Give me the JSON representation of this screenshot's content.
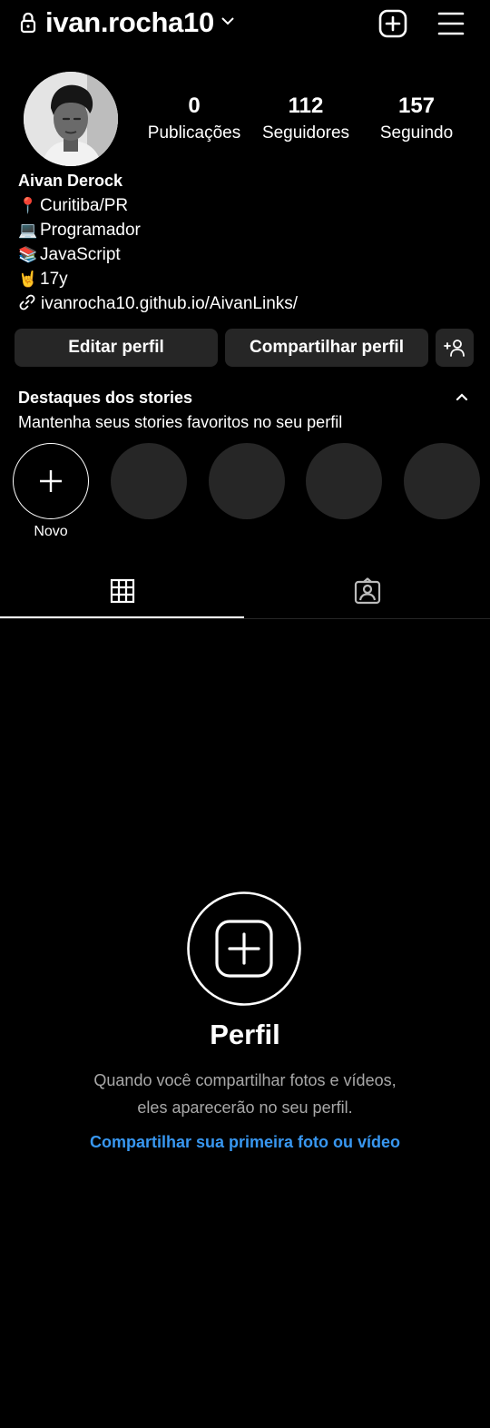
{
  "header": {
    "username": "ivan.rocha10"
  },
  "profile": {
    "stats": [
      {
        "value": "0",
        "label": "Publicações"
      },
      {
        "value": "112",
        "label": "Seguidores"
      },
      {
        "value": "157",
        "label": "Seguindo"
      }
    ],
    "name": "Aivan Derock",
    "bio_lines": [
      {
        "emoji": "📍",
        "text": "Curitiba/PR"
      },
      {
        "emoji": "💻",
        "text": "Programador"
      },
      {
        "emoji": "📚",
        "text": "JavaScript"
      },
      {
        "emoji": "🤘",
        "text": "17y"
      }
    ],
    "link": "ivanrocha10.github.io/AivanLinks/"
  },
  "actions": {
    "edit_label": "Editar perfil",
    "share_label": "Compartilhar perfil"
  },
  "highlights": {
    "title": "Destaques dos stories",
    "subtitle": "Mantenha seus stories favoritos no seu perfil",
    "new_label": "Novo"
  },
  "empty_state": {
    "title": "Perfil",
    "description": "Quando você compartilhar fotos e vídeos, eles aparecerão no seu perfil.",
    "cta": "Compartilhar sua primeira foto ou vídeo"
  },
  "colors": {
    "background": "#000000",
    "button_bg": "#262626",
    "link_blue": "#3897f0",
    "muted_text": "#a8a8a8"
  },
  "icons": [
    "lock-icon",
    "chevron-down-icon",
    "add-post-icon",
    "menu-icon",
    "link-icon",
    "add-person-icon",
    "collapse-icon",
    "plus-icon",
    "grid-icon",
    "tagged-icon"
  ]
}
